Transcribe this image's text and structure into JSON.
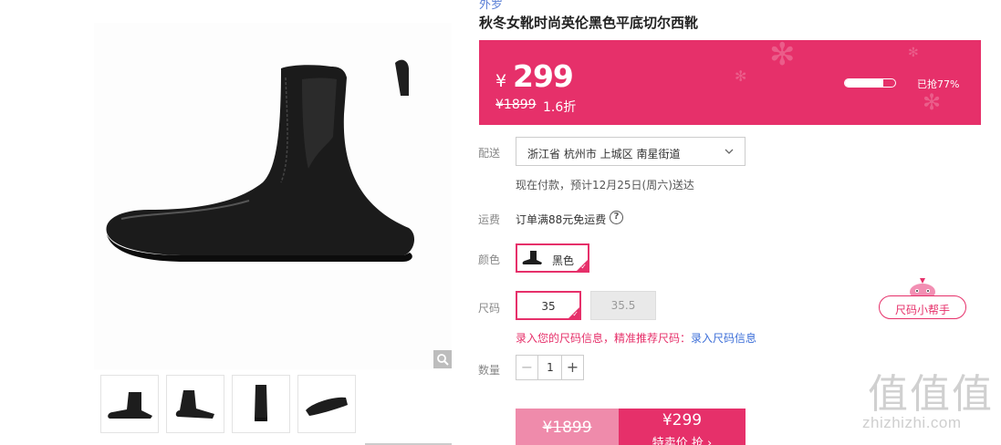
{
  "product": {
    "brand_partial": "外罗",
    "title": "秋冬女靴时尚英伦黑色平底切尔西靴"
  },
  "price_banner": {
    "currency": "¥",
    "price": "299",
    "original_price": "¥1899",
    "discount": "1.6折",
    "sold_fraction": 0.77,
    "sold_label": "已抢77%",
    "bg_color": "#e6306a"
  },
  "delivery": {
    "label": "配送",
    "address": "浙江省 杭州市 上城区 南星街道",
    "note": "现在付款，预计12月25日(周六)送达"
  },
  "shipping": {
    "label": "运费",
    "text": "订单满88元免运费",
    "help_icon": "?"
  },
  "color": {
    "label": "颜色",
    "selected": "黑色"
  },
  "size": {
    "label": "尺码",
    "options": [
      "35",
      "35.5"
    ],
    "helper": "尺码小帮手",
    "prompt_pink": "录入您的尺码信息，精准推荐尺码：",
    "prompt_link": "录入尺码信息"
  },
  "quantity": {
    "label": "数量",
    "minus": "−",
    "value": "1",
    "plus": "+"
  },
  "buy": {
    "original": "¥1899",
    "price": "¥299",
    "action": "特卖价 抢 ›"
  },
  "watermark": {
    "glyphs": "值值值",
    "site": "zhizhizhi.com"
  },
  "icons": [
    "search-icon",
    "chevron-down-icon",
    "check-icon",
    "help-icon",
    "snowflake-icon"
  ]
}
